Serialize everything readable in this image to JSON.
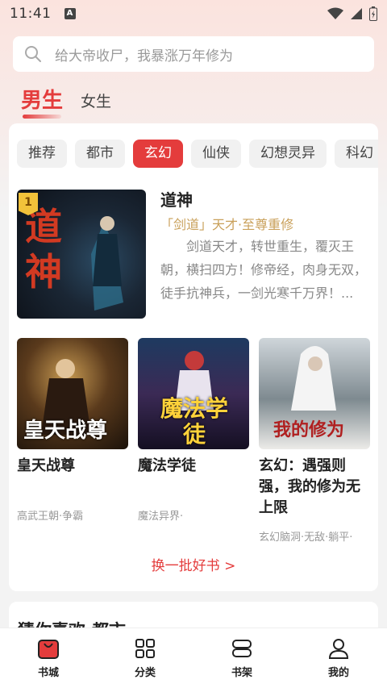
{
  "status": {
    "time": "11:41",
    "notification_letter": "A"
  },
  "search": {
    "placeholder": "给大帝收尸，我暴涨万年修为"
  },
  "gender_tabs": {
    "male": "男生",
    "female": "女生"
  },
  "categories": [
    "推荐",
    "都市",
    "玄幻",
    "仙侠",
    "幻想灵异",
    "科幻"
  ],
  "active_category": "玄幻",
  "featured": {
    "rank": "1",
    "title": "道神",
    "tag": "「剑道」天才·至尊重修",
    "description": "剑道天才，转世重生，覆灭王朝，横扫四方！修帝经，肉身无双，徒手抗神兵，一剑光寒千万界！...",
    "cover_text": "道神"
  },
  "books": [
    {
      "title": "皇天战尊",
      "meta": "高武王朝·争霸",
      "cover_text": "皇天战尊"
    },
    {
      "title": "魔法学徒",
      "meta": "魔法异界·",
      "cover_text": "魔法学徒"
    },
    {
      "title": "玄幻：遇强则强，我的修为无上限",
      "meta": "玄幻脑洞·无敌·躺平·",
      "cover_text": "我的修为"
    }
  ],
  "refresh_label": "换一批好书 >",
  "section2_title": "猜你喜欢·都市",
  "bottom_nav": [
    {
      "label": "书城",
      "icon": "bookstore-icon"
    },
    {
      "label": "分类",
      "icon": "category-grid-icon"
    },
    {
      "label": "书架",
      "icon": "bookshelf-icon"
    },
    {
      "label": "我的",
      "icon": "profile-icon"
    }
  ],
  "colors": {
    "accent": "#e43c3c",
    "tag_gold": "#c9a05a"
  }
}
